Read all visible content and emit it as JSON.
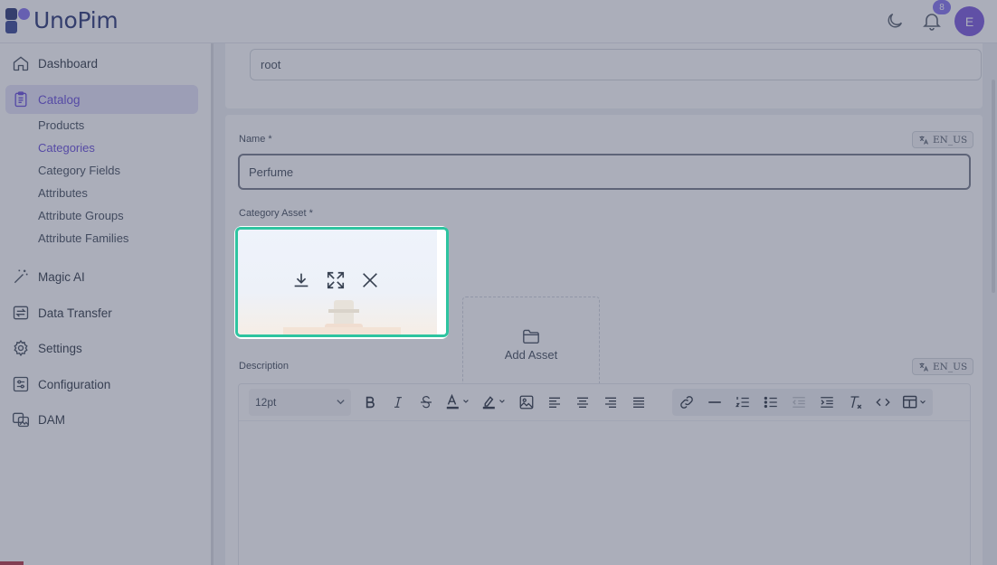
{
  "app": {
    "logo_text": "UnoPim",
    "notifications_count": "8",
    "avatar_initial": "E"
  },
  "sidebar": {
    "items": [
      {
        "label": "Dashboard",
        "icon": "home-icon"
      },
      {
        "label": "Catalog",
        "icon": "clipboard-icon",
        "active": true
      },
      {
        "label": "Magic AI",
        "icon": "magic-wand-icon"
      },
      {
        "label": "Data Transfer",
        "icon": "transfer-icon"
      },
      {
        "label": "Settings",
        "icon": "gear-icon"
      },
      {
        "label": "Configuration",
        "icon": "sliders-icon"
      },
      {
        "label": "DAM",
        "icon": "dam-icon"
      }
    ],
    "catalog_sub": [
      {
        "label": "Products"
      },
      {
        "label": "Categories",
        "active": true
      },
      {
        "label": "Category Fields"
      },
      {
        "label": "Attributes"
      },
      {
        "label": "Attribute Groups"
      },
      {
        "label": "Attribute Families"
      }
    ]
  },
  "form": {
    "parent_value": "root",
    "name_label": "Name *",
    "name_locale": "EN_US",
    "name_value": "Perfume",
    "asset_label": "Category Asset *",
    "add_asset_label": "Add Asset",
    "description_label": "Description",
    "description_locale": "EN_US"
  },
  "editor": {
    "font_size": "12pt"
  },
  "colors": {
    "accent": "#5b3fd6",
    "active_bg": "#e2e0f7",
    "asset_highlight": "#2ec4a0",
    "avatar_bg": "#6f4bd8"
  }
}
